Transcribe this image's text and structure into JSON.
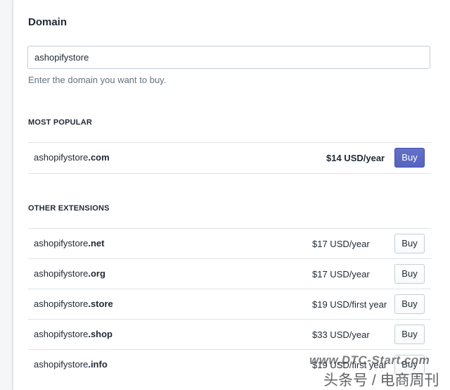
{
  "section": {
    "title": "Domain",
    "input_value": "ashopifystore",
    "help_text": "Enter the domain you want to buy."
  },
  "most_popular": {
    "label": "MOST POPULAR",
    "items": [
      {
        "name": "ashopifystore",
        "tld": ".com",
        "price": "$14 USD/year",
        "button": "Buy"
      }
    ]
  },
  "other_extensions": {
    "label": "OTHER EXTENSIONS",
    "items": [
      {
        "name": "ashopifystore",
        "tld": ".net",
        "price": "$17 USD/year",
        "button": "Buy"
      },
      {
        "name": "ashopifystore",
        "tld": ".org",
        "price": "$17 USD/year",
        "button": "Buy"
      },
      {
        "name": "ashopifystore",
        "tld": ".store",
        "price": "$19 USD/first year",
        "button": "Buy"
      },
      {
        "name": "ashopifystore",
        "tld": ".shop",
        "price": "$33 USD/year",
        "button": "Buy"
      },
      {
        "name": "ashopifystore",
        "tld": ".info",
        "price": "$19 USD/first year",
        "button": "Buy"
      }
    ]
  },
  "watermark": {
    "line1": "www.DTC-Start.com",
    "line2": "头条号 / 电商周刊"
  },
  "colors": {
    "primary_button": "#5c6ac4",
    "border": "#dfe3e8",
    "muted_text": "#637381"
  }
}
